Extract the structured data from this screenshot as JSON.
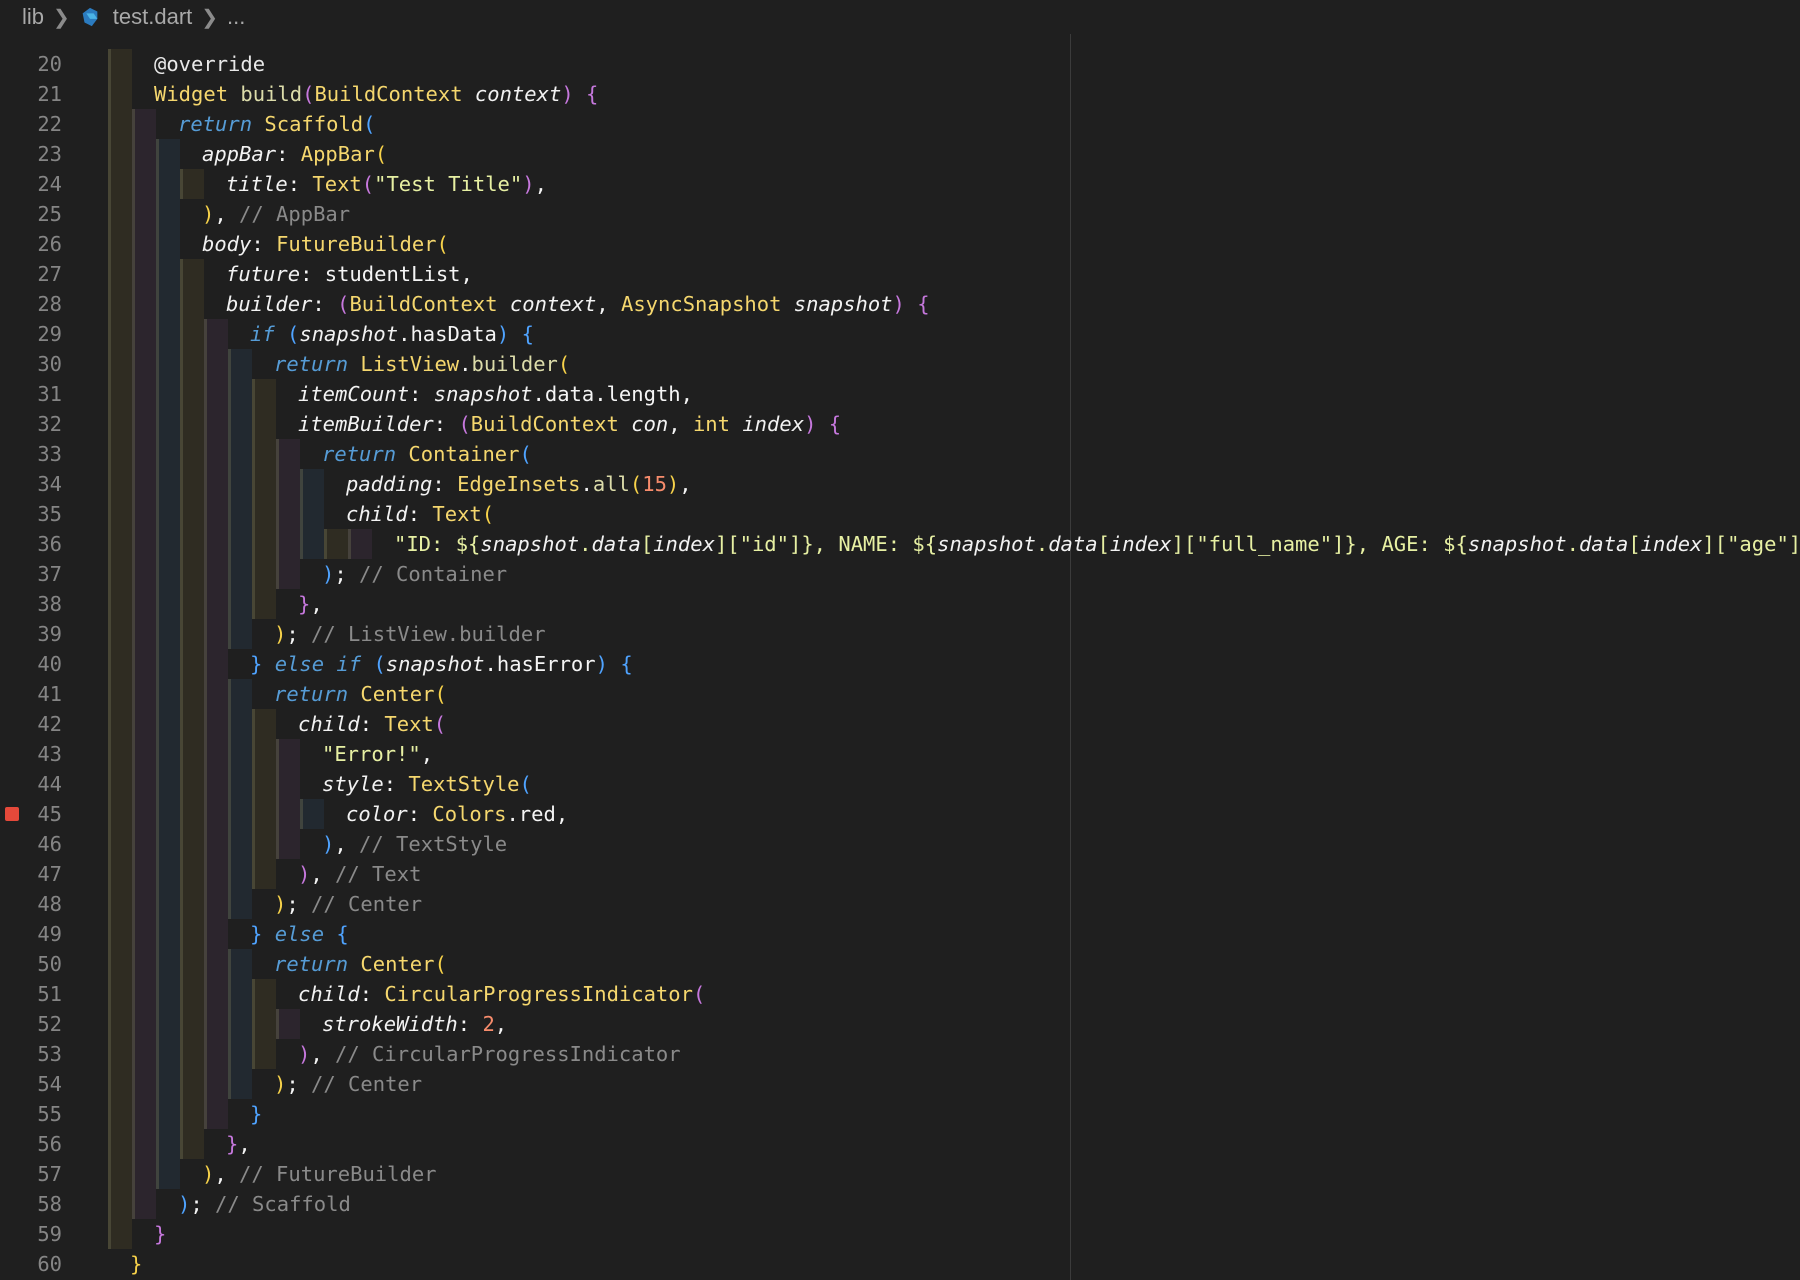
{
  "breadcrumb": {
    "root": "lib",
    "file": "test.dart",
    "more": "..."
  },
  "editor": {
    "breakpoint_line": "45",
    "lines": [
      {
        "n": "20",
        "indent": 1,
        "tokens": [
          [
            "at",
            "@override"
          ]
        ]
      },
      {
        "n": "21",
        "indent": 1,
        "tokens": [
          [
            "ty",
            "Widget "
          ],
          [
            "fn",
            "build"
          ],
          [
            "p2",
            "("
          ],
          [
            "ty",
            "BuildContext "
          ],
          [
            "it",
            "context"
          ],
          [
            "p2",
            ")"
          ],
          [
            "nm",
            " "
          ],
          [
            "p2",
            "{"
          ]
        ]
      },
      {
        "n": "22",
        "indent": 2,
        "tokens": [
          [
            "kw",
            "return "
          ],
          [
            "ty",
            "Scaffold"
          ],
          [
            "p3",
            "("
          ]
        ]
      },
      {
        "n": "23",
        "indent": 3,
        "tokens": [
          [
            "it",
            "appBar"
          ],
          [
            "nm",
            ": "
          ],
          [
            "ty",
            "AppBar"
          ],
          [
            "p1",
            "("
          ]
        ]
      },
      {
        "n": "24",
        "indent": 4,
        "tokens": [
          [
            "it",
            "title"
          ],
          [
            "nm",
            ": "
          ],
          [
            "ty",
            "Text"
          ],
          [
            "p2",
            "("
          ],
          [
            "st",
            "\"Test Title\""
          ],
          [
            "p2",
            ")"
          ],
          [
            "nm",
            ","
          ]
        ]
      },
      {
        "n": "25",
        "indent": 3,
        "tokens": [
          [
            "p1",
            ")"
          ],
          [
            "nm",
            ", "
          ],
          [
            "cm",
            "// AppBar"
          ]
        ]
      },
      {
        "n": "26",
        "indent": 3,
        "tokens": [
          [
            "it",
            "body"
          ],
          [
            "nm",
            ": "
          ],
          [
            "ty",
            "FutureBuilder"
          ],
          [
            "p1",
            "("
          ]
        ]
      },
      {
        "n": "27",
        "indent": 4,
        "tokens": [
          [
            "it",
            "future"
          ],
          [
            "nm",
            ": studentList,"
          ]
        ]
      },
      {
        "n": "28",
        "indent": 4,
        "tokens": [
          [
            "it",
            "builder"
          ],
          [
            "nm",
            ": "
          ],
          [
            "p2",
            "("
          ],
          [
            "ty",
            "BuildContext "
          ],
          [
            "it",
            "context"
          ],
          [
            "nm",
            ", "
          ],
          [
            "ty",
            "AsyncSnapshot "
          ],
          [
            "it",
            "snapshot"
          ],
          [
            "p2",
            ")"
          ],
          [
            "nm",
            " "
          ],
          [
            "p2",
            "{"
          ]
        ]
      },
      {
        "n": "29",
        "indent": 5,
        "tokens": [
          [
            "kw",
            "if "
          ],
          [
            "p3",
            "("
          ],
          [
            "it",
            "snapshot"
          ],
          [
            "nm",
            ".hasData"
          ],
          [
            "p3",
            ")"
          ],
          [
            "nm",
            " "
          ],
          [
            "p3",
            "{"
          ]
        ]
      },
      {
        "n": "30",
        "indent": 6,
        "tokens": [
          [
            "kw",
            "return "
          ],
          [
            "ty",
            "ListView"
          ],
          [
            "nm",
            "."
          ],
          [
            "fn",
            "builder"
          ],
          [
            "p1",
            "("
          ]
        ]
      },
      {
        "n": "31",
        "indent": 7,
        "tokens": [
          [
            "it",
            "itemCount"
          ],
          [
            "nm",
            ": "
          ],
          [
            "it",
            "snapshot"
          ],
          [
            "nm",
            ".data.length,"
          ]
        ]
      },
      {
        "n": "32",
        "indent": 7,
        "tokens": [
          [
            "it",
            "itemBuilder"
          ],
          [
            "nm",
            ": "
          ],
          [
            "p2",
            "("
          ],
          [
            "ty",
            "BuildContext "
          ],
          [
            "it",
            "con"
          ],
          [
            "nm",
            ", "
          ],
          [
            "ty",
            "int "
          ],
          [
            "it",
            "index"
          ],
          [
            "p2",
            ")"
          ],
          [
            "nm",
            " "
          ],
          [
            "p2",
            "{"
          ]
        ]
      },
      {
        "n": "33",
        "indent": 8,
        "tokens": [
          [
            "kw",
            "return "
          ],
          [
            "ty",
            "Container"
          ],
          [
            "p3",
            "("
          ]
        ]
      },
      {
        "n": "34",
        "indent": 9,
        "tokens": [
          [
            "it",
            "padding"
          ],
          [
            "nm",
            ": "
          ],
          [
            "ty",
            "EdgeInsets"
          ],
          [
            "nm",
            "."
          ],
          [
            "fn",
            "all"
          ],
          [
            "p1",
            "("
          ],
          [
            "num",
            "15"
          ],
          [
            "p1",
            ")"
          ],
          [
            "nm",
            ","
          ]
        ]
      },
      {
        "n": "35",
        "indent": 9,
        "tokens": [
          [
            "it",
            "child"
          ],
          [
            "nm",
            ": "
          ],
          [
            "ty",
            "Text"
          ],
          [
            "p1",
            "("
          ]
        ]
      },
      {
        "n": "36",
        "indent": 11,
        "tokens": [
          [
            "st",
            "\"ID: ${"
          ],
          [
            "it",
            "snapshot"
          ],
          [
            "st",
            "."
          ],
          [
            "it",
            "data"
          ],
          [
            "st",
            "["
          ],
          [
            "it",
            "index"
          ],
          [
            "st",
            "][\"id\"]}, NAME: ${"
          ],
          [
            "it",
            "snapshot"
          ],
          [
            "st",
            "."
          ],
          [
            "it",
            "data"
          ],
          [
            "st",
            "["
          ],
          [
            "it",
            "index"
          ],
          [
            "st",
            "][\"full_name\"]}, AGE: ${"
          ],
          [
            "it",
            "snapshot"
          ],
          [
            "st",
            "."
          ],
          [
            "it",
            "data"
          ],
          [
            "st",
            "["
          ],
          [
            "it",
            "index"
          ],
          [
            "st",
            "][\"age\"]}\""
          ],
          [
            "p1",
            ")"
          ],
          [
            "nm",
            ","
          ]
        ]
      },
      {
        "n": "37",
        "indent": 8,
        "tokens": [
          [
            "p3",
            ")"
          ],
          [
            "nm",
            "; "
          ],
          [
            "cm",
            "// Container"
          ]
        ]
      },
      {
        "n": "38",
        "indent": 7,
        "tokens": [
          [
            "p2",
            "}"
          ],
          [
            "nm",
            ","
          ]
        ]
      },
      {
        "n": "39",
        "indent": 6,
        "tokens": [
          [
            "p1",
            ")"
          ],
          [
            "nm",
            "; "
          ],
          [
            "cm",
            "// ListView.builder"
          ]
        ]
      },
      {
        "n": "40",
        "indent": 5,
        "tokens": [
          [
            "p3",
            "} "
          ],
          [
            "kw",
            "else if "
          ],
          [
            "p3",
            "("
          ],
          [
            "it",
            "snapshot"
          ],
          [
            "nm",
            ".hasError"
          ],
          [
            "p3",
            ")"
          ],
          [
            "nm",
            " "
          ],
          [
            "p3",
            "{"
          ]
        ]
      },
      {
        "n": "41",
        "indent": 6,
        "tokens": [
          [
            "kw",
            "return "
          ],
          [
            "ty",
            "Center"
          ],
          [
            "p1",
            "("
          ]
        ]
      },
      {
        "n": "42",
        "indent": 7,
        "tokens": [
          [
            "it",
            "child"
          ],
          [
            "nm",
            ": "
          ],
          [
            "ty",
            "Text"
          ],
          [
            "p2",
            "("
          ]
        ]
      },
      {
        "n": "43",
        "indent": 8,
        "tokens": [
          [
            "st",
            "\"Error!\""
          ],
          [
            "nm",
            ","
          ]
        ]
      },
      {
        "n": "44",
        "indent": 8,
        "tokens": [
          [
            "it",
            "style"
          ],
          [
            "nm",
            ": "
          ],
          [
            "ty",
            "TextStyle"
          ],
          [
            "p3",
            "("
          ]
        ]
      },
      {
        "n": "45",
        "indent": 9,
        "tokens": [
          [
            "it",
            "color"
          ],
          [
            "nm",
            ": "
          ],
          [
            "ty",
            "Colors"
          ],
          [
            "nm",
            ".red,"
          ]
        ]
      },
      {
        "n": "46",
        "indent": 8,
        "tokens": [
          [
            "p3",
            ")"
          ],
          [
            "nm",
            ", "
          ],
          [
            "cm",
            "// TextStyle"
          ]
        ]
      },
      {
        "n": "47",
        "indent": 7,
        "tokens": [
          [
            "p2",
            ")"
          ],
          [
            "nm",
            ", "
          ],
          [
            "cm",
            "// Text"
          ]
        ]
      },
      {
        "n": "48",
        "indent": 6,
        "tokens": [
          [
            "p1",
            ")"
          ],
          [
            "nm",
            "; "
          ],
          [
            "cm",
            "// Center"
          ]
        ]
      },
      {
        "n": "49",
        "indent": 5,
        "tokens": [
          [
            "p3",
            "} "
          ],
          [
            "kw",
            "else "
          ],
          [
            "p3",
            "{"
          ]
        ]
      },
      {
        "n": "50",
        "indent": 6,
        "tokens": [
          [
            "kw",
            "return "
          ],
          [
            "ty",
            "Center"
          ],
          [
            "p1",
            "("
          ]
        ]
      },
      {
        "n": "51",
        "indent": 7,
        "tokens": [
          [
            "it",
            "child"
          ],
          [
            "nm",
            ": "
          ],
          [
            "ty",
            "CircularProgressIndicator"
          ],
          [
            "p2",
            "("
          ]
        ]
      },
      {
        "n": "52",
        "indent": 8,
        "tokens": [
          [
            "it",
            "strokeWidth"
          ],
          [
            "nm",
            ": "
          ],
          [
            "num",
            "2"
          ],
          [
            "nm",
            ","
          ]
        ]
      },
      {
        "n": "53",
        "indent": 7,
        "tokens": [
          [
            "p2",
            ")"
          ],
          [
            "nm",
            ", "
          ],
          [
            "cm",
            "// CircularProgressIndicator"
          ]
        ]
      },
      {
        "n": "54",
        "indent": 6,
        "tokens": [
          [
            "p1",
            ")"
          ],
          [
            "nm",
            "; "
          ],
          [
            "cm",
            "// Center"
          ]
        ]
      },
      {
        "n": "55",
        "indent": 5,
        "tokens": [
          [
            "p3",
            "}"
          ]
        ]
      },
      {
        "n": "56",
        "indent": 4,
        "tokens": [
          [
            "p2",
            "}"
          ],
          [
            "nm",
            ","
          ]
        ]
      },
      {
        "n": "57",
        "indent": 3,
        "tokens": [
          [
            "p1",
            ")"
          ],
          [
            "nm",
            ", "
          ],
          [
            "cm",
            "// FutureBuilder"
          ]
        ]
      },
      {
        "n": "58",
        "indent": 2,
        "tokens": [
          [
            "p3",
            ")"
          ],
          [
            "nm",
            "; "
          ],
          [
            "cm",
            "// Scaffold"
          ]
        ]
      },
      {
        "n": "59",
        "indent": 1,
        "tokens": [
          [
            "p2",
            "}"
          ]
        ]
      },
      {
        "n": "60",
        "indent": 0,
        "tokens": [
          [
            "p1",
            "}"
          ]
        ]
      }
    ]
  }
}
